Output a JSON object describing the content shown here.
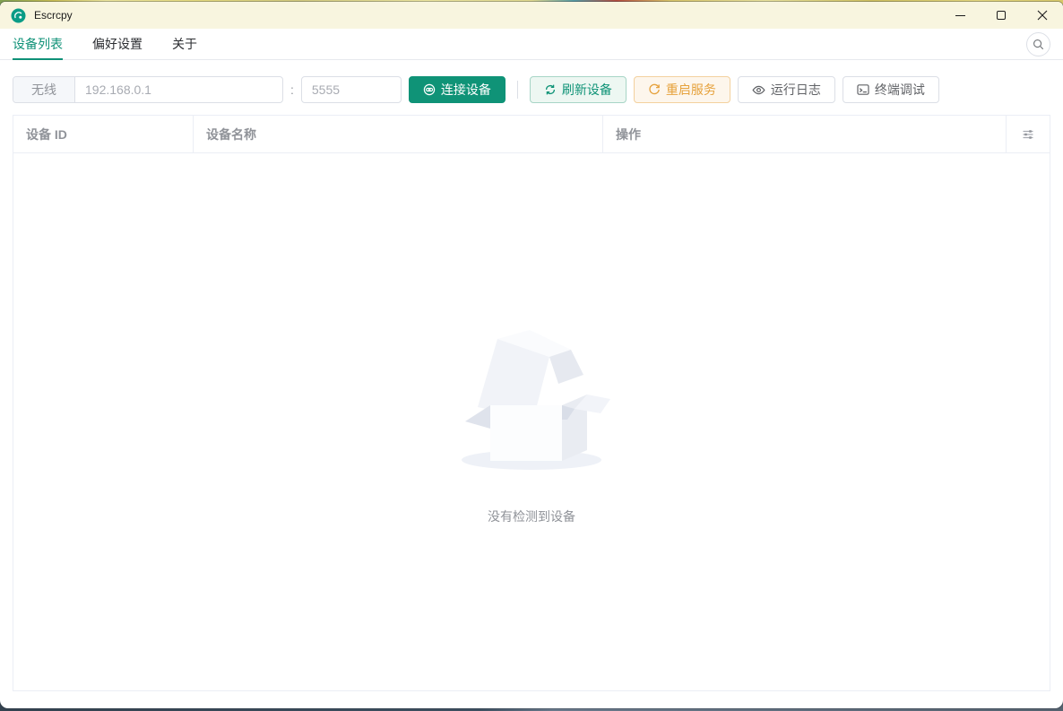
{
  "window": {
    "title": "Escrcpy"
  },
  "tabs": [
    {
      "label": "设备列表",
      "active": true
    },
    {
      "label": "偏好设置",
      "active": false
    },
    {
      "label": "关于",
      "active": false
    }
  ],
  "toolbar": {
    "wireless_label": "无线",
    "ip_placeholder": "192.168.0.1",
    "port_separator": ":",
    "port_placeholder": "5555",
    "connect_label": "连接设备",
    "refresh_label": "刷新设备",
    "restart_label": "重启服务",
    "logs_label": "运行日志",
    "terminal_label": "终端调试"
  },
  "table": {
    "columns": [
      "设备 ID",
      "设备名称",
      "操作"
    ]
  },
  "empty": {
    "text": "没有检测到设备"
  },
  "icons": {
    "app_logo": "escrcpy-logo",
    "minimize": "minimize-bar",
    "maximize": "maximize-square",
    "close": "close-x",
    "search": "magnifier",
    "connect": "link",
    "refresh": "circular-refresh-arrows",
    "restart": "refresh-right-arrow",
    "logs": "eye",
    "terminal": "terminal-window",
    "column_settings": "sliders"
  },
  "colors": {
    "primary_green": "#0f9377",
    "warning_orange": "#e6a23c",
    "titlebar_cream": "#f8f5df",
    "muted_text": "#909399",
    "border": "#dcdfe6"
  }
}
